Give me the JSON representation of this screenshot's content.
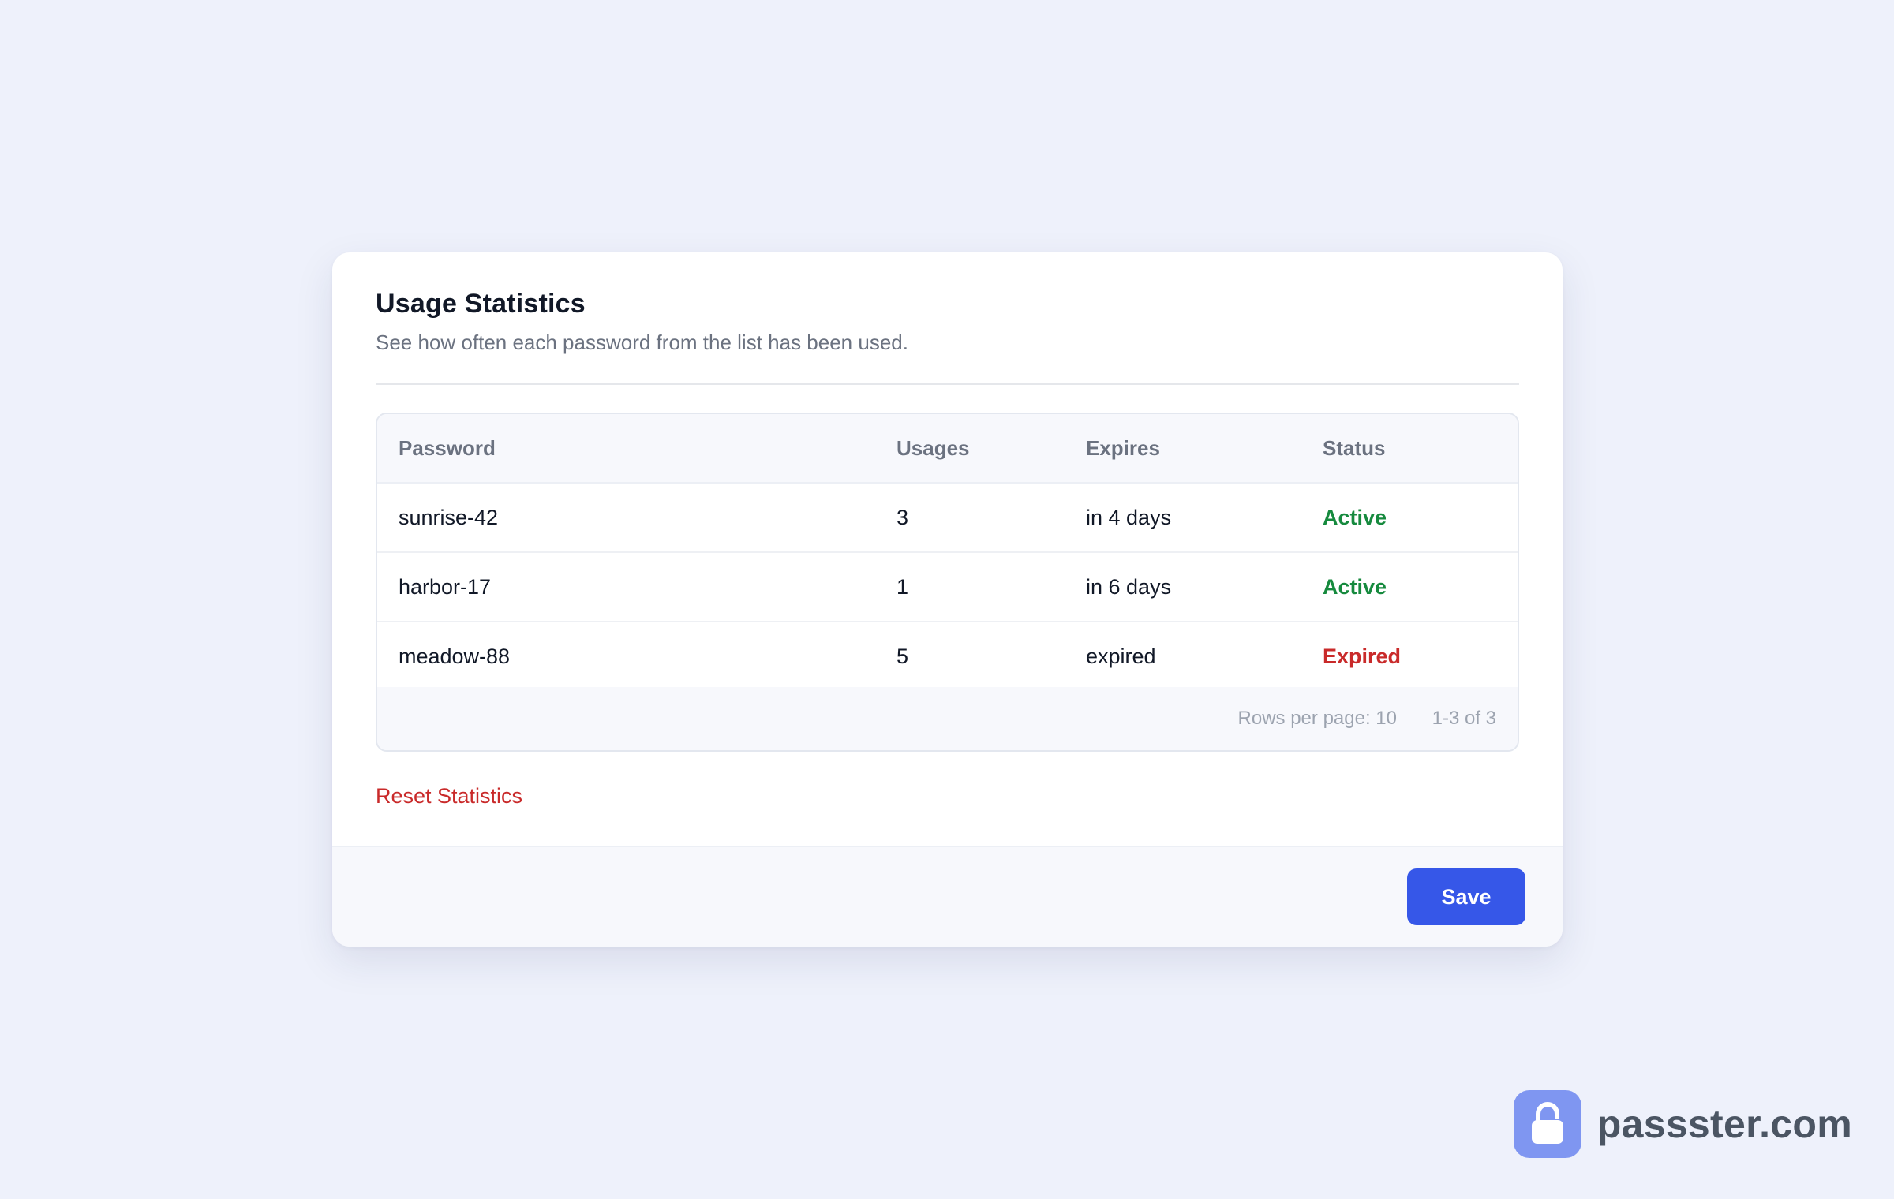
{
  "card": {
    "title": "Usage Statistics",
    "subtitle": "See how often each password from the list has been used."
  },
  "table": {
    "columns": [
      "Password",
      "Usages",
      "Expires",
      "Status"
    ],
    "rows": [
      {
        "password": "sunrise-42",
        "usages": "3",
        "expires": "in 4 days",
        "status": "Active"
      },
      {
        "password": "harbor-17",
        "usages": "1",
        "expires": "in 6 days",
        "status": "Active"
      },
      {
        "password": "meadow-88",
        "usages": "5",
        "expires": "expired",
        "status": "Expired"
      }
    ],
    "rows_per_page": "Rows per page: 10",
    "range": "1-3 of 3"
  },
  "actions": {
    "reset_label": "Reset Statistics",
    "save_label": "Save"
  },
  "brand": {
    "name": "passster.com",
    "icon": "lock-icon"
  },
  "colors": {
    "accent": "#3657e8",
    "active": "#168a3e",
    "expired": "#c92a2a",
    "background": "#eef1fb"
  }
}
